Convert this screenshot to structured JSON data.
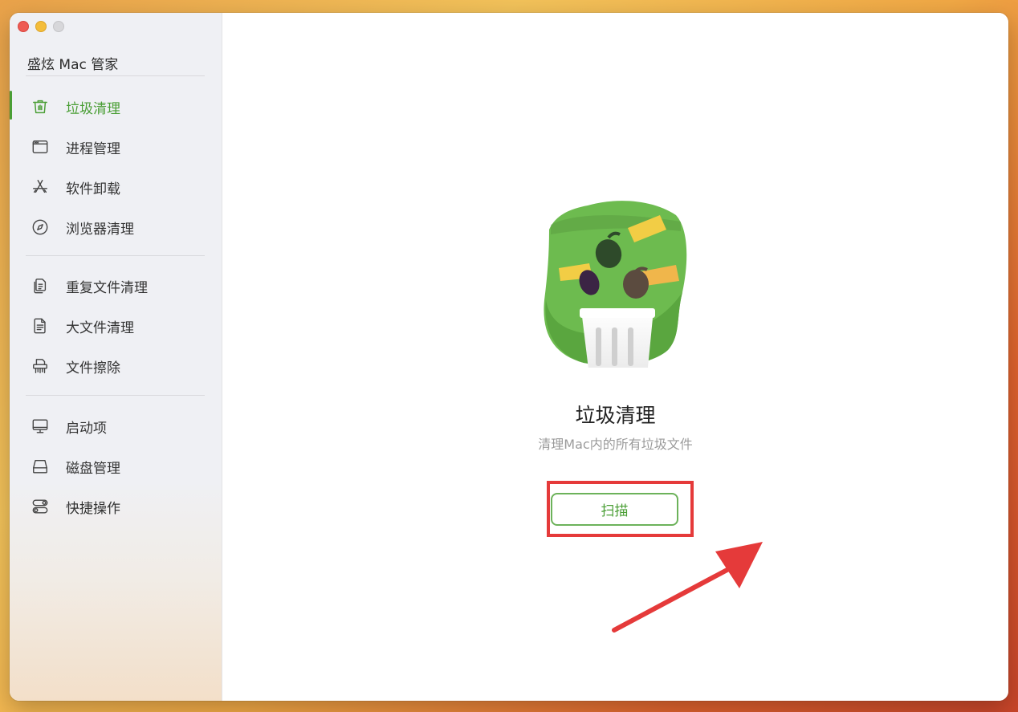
{
  "app": {
    "title": "盛炫 Mac 管家"
  },
  "sidebar": {
    "groups": [
      {
        "items": [
          {
            "label": "垃圾清理",
            "icon": "trash-icon",
            "active": true
          },
          {
            "label": "进程管理",
            "icon": "window-icon",
            "active": false
          },
          {
            "label": "软件卸载",
            "icon": "app-store-icon",
            "active": false
          },
          {
            "label": "浏览器清理",
            "icon": "compass-icon",
            "active": false
          }
        ]
      },
      {
        "items": [
          {
            "label": "重复文件清理",
            "icon": "duplicate-files-icon",
            "active": false
          },
          {
            "label": "大文件清理",
            "icon": "document-icon",
            "active": false
          },
          {
            "label": "文件擦除",
            "icon": "shredder-icon",
            "active": false
          }
        ]
      },
      {
        "items": [
          {
            "label": "启动项",
            "icon": "monitor-icon",
            "active": false
          },
          {
            "label": "磁盘管理",
            "icon": "disk-icon",
            "active": false
          },
          {
            "label": "快捷操作",
            "icon": "toggles-icon",
            "active": false
          }
        ]
      }
    ]
  },
  "main": {
    "title": "垃圾清理",
    "subtitle": "清理Mac内的所有垃圾文件",
    "scan_label": "扫描",
    "illustration_icon": "trash-can-illustration"
  },
  "colors": {
    "accent": "#4a9e35",
    "highlight": "#e53a3a"
  }
}
